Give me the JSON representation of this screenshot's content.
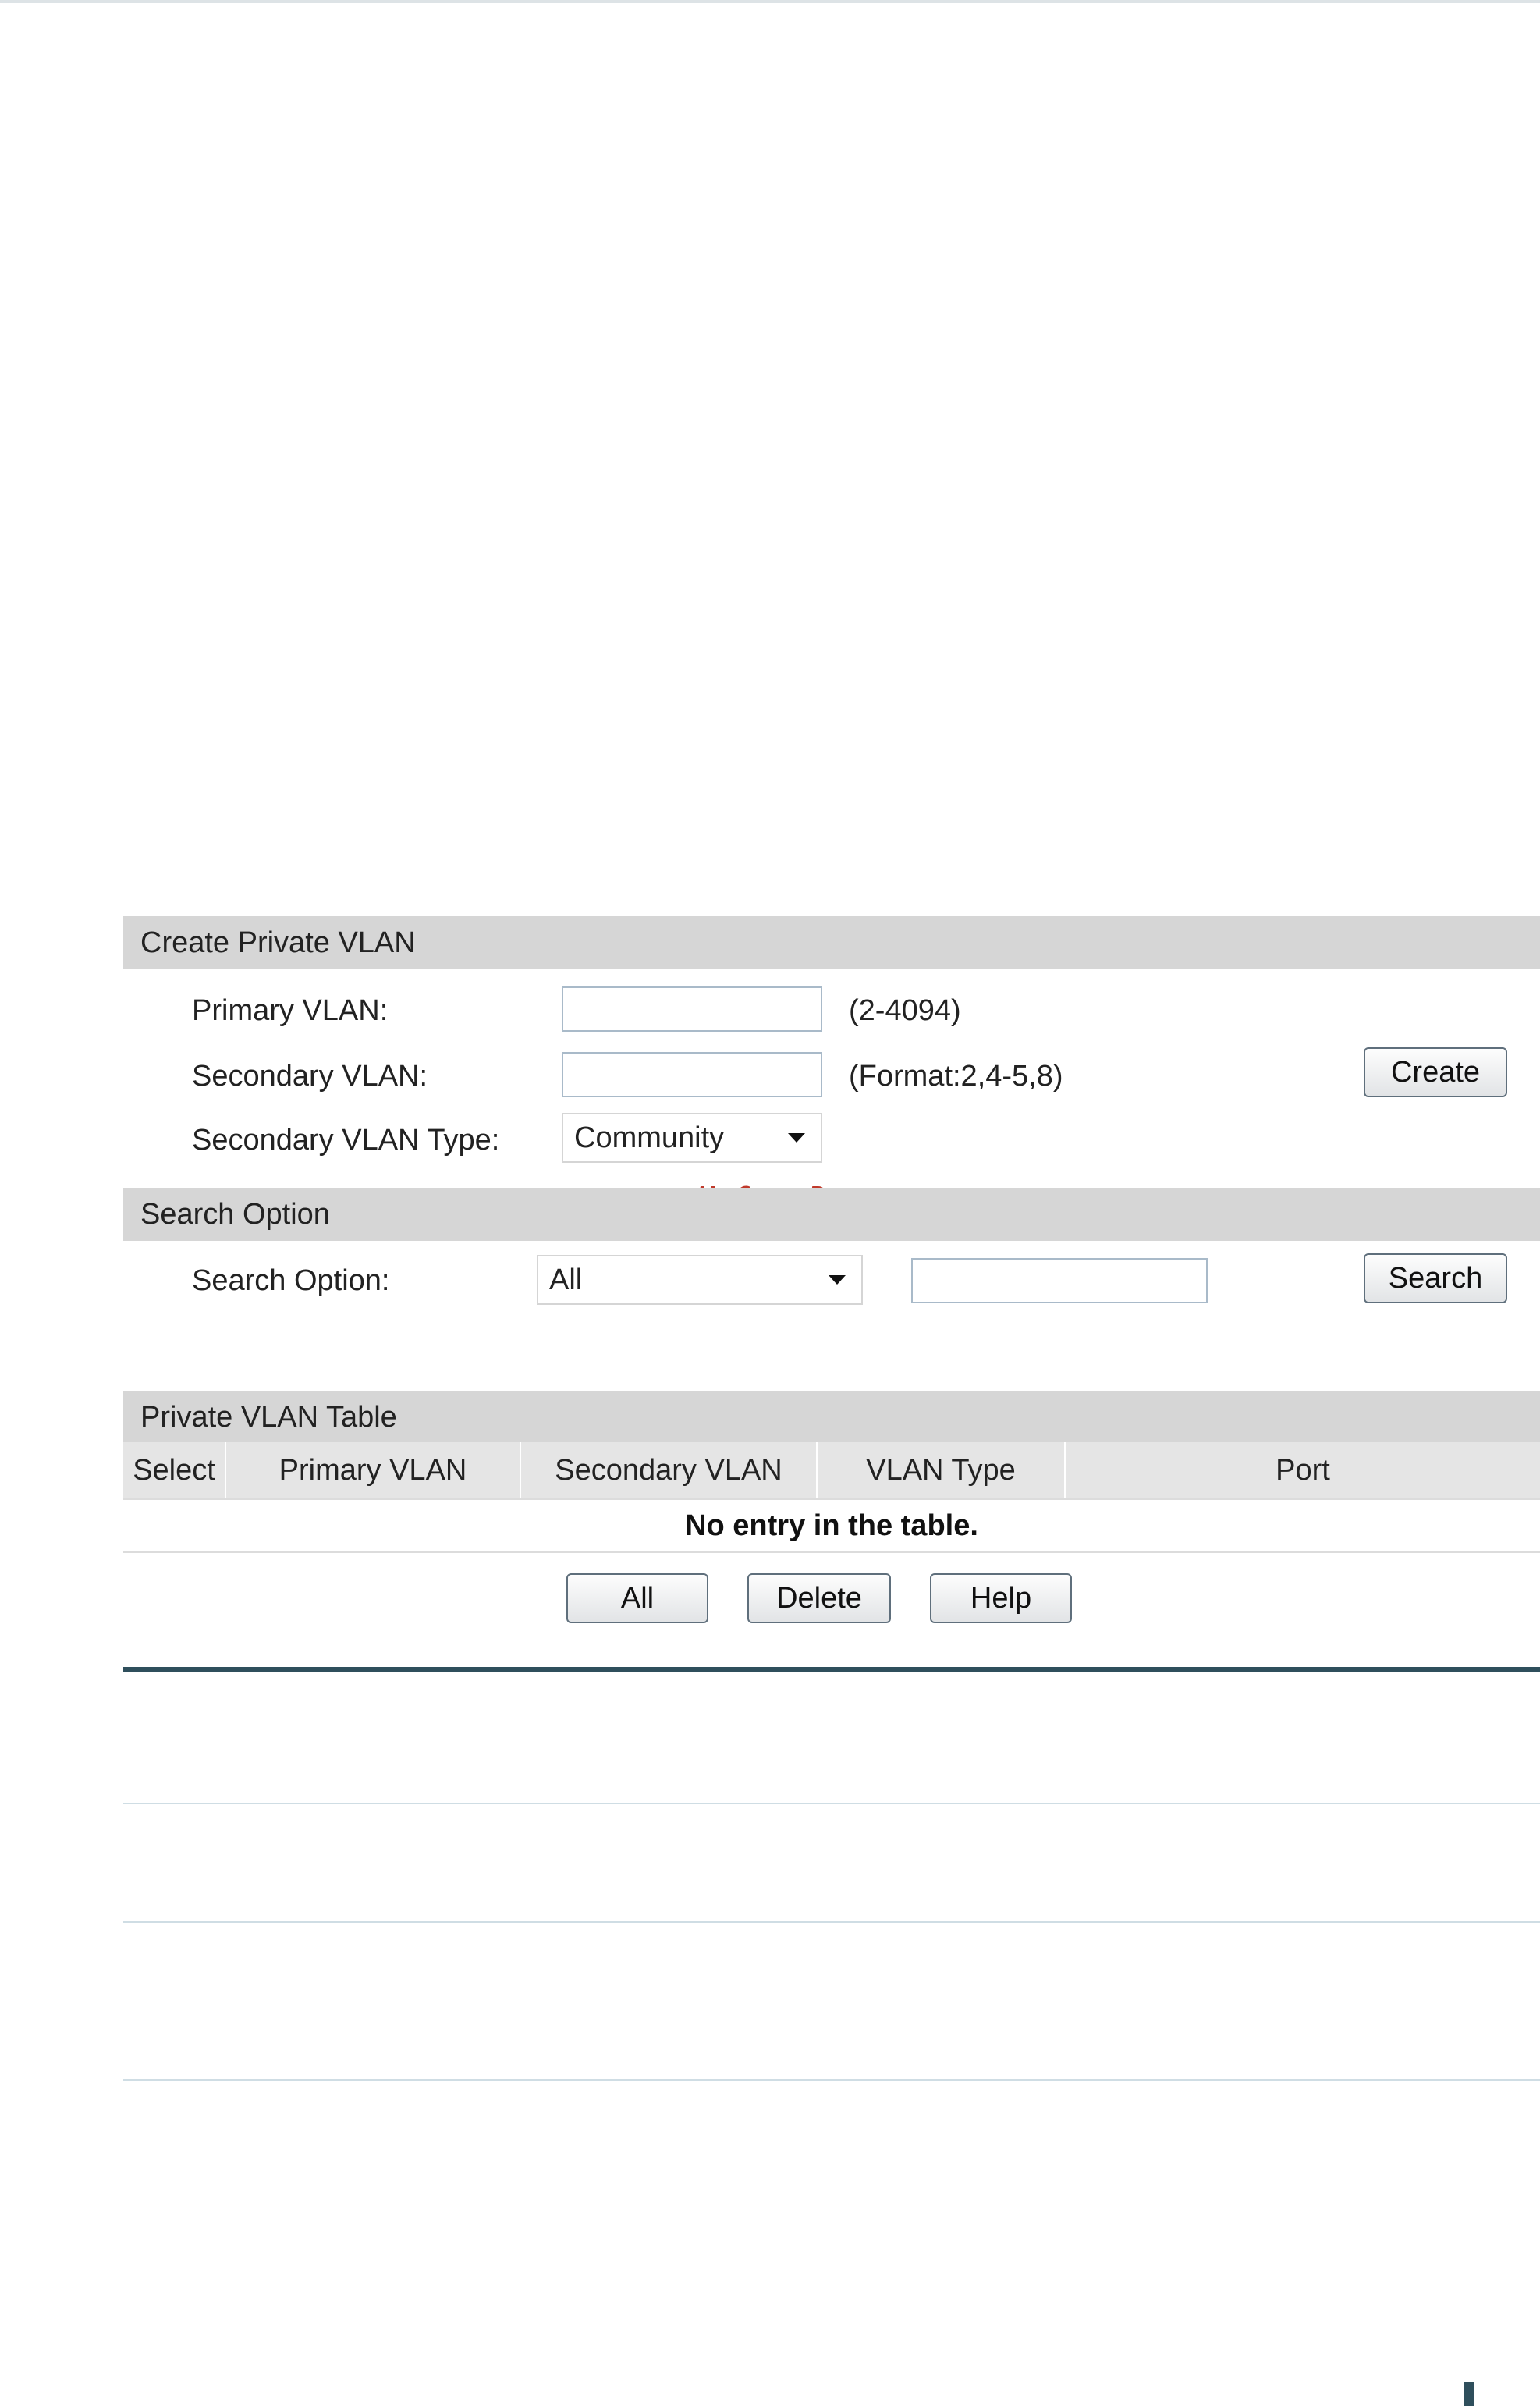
{
  "create_panel": {
    "title": "Create Private VLAN",
    "primary_label": "Primary VLAN:",
    "primary_value": "",
    "primary_hint": "(2-4094)",
    "secondary_label": "Secondary VLAN:",
    "secondary_value": "",
    "secondary_hint": "(Format:2,4-5,8)",
    "type_label": "Secondary VLAN Type:",
    "type_selected": "Community",
    "create_button": "Create"
  },
  "watermark": "McGrp.Ru",
  "search_panel": {
    "title": "Search Option",
    "label": "Search Option:",
    "selected": "All",
    "query_value": "",
    "search_button": "Search"
  },
  "table_panel": {
    "title": "Private VLAN Table",
    "columns": [
      "Select",
      "Primary VLAN",
      "Secondary VLAN",
      "VLAN Type",
      "Port"
    ],
    "empty_message": "No entry in the table.",
    "buttons": {
      "all": "All",
      "delete": "Delete",
      "help": "Help"
    }
  }
}
